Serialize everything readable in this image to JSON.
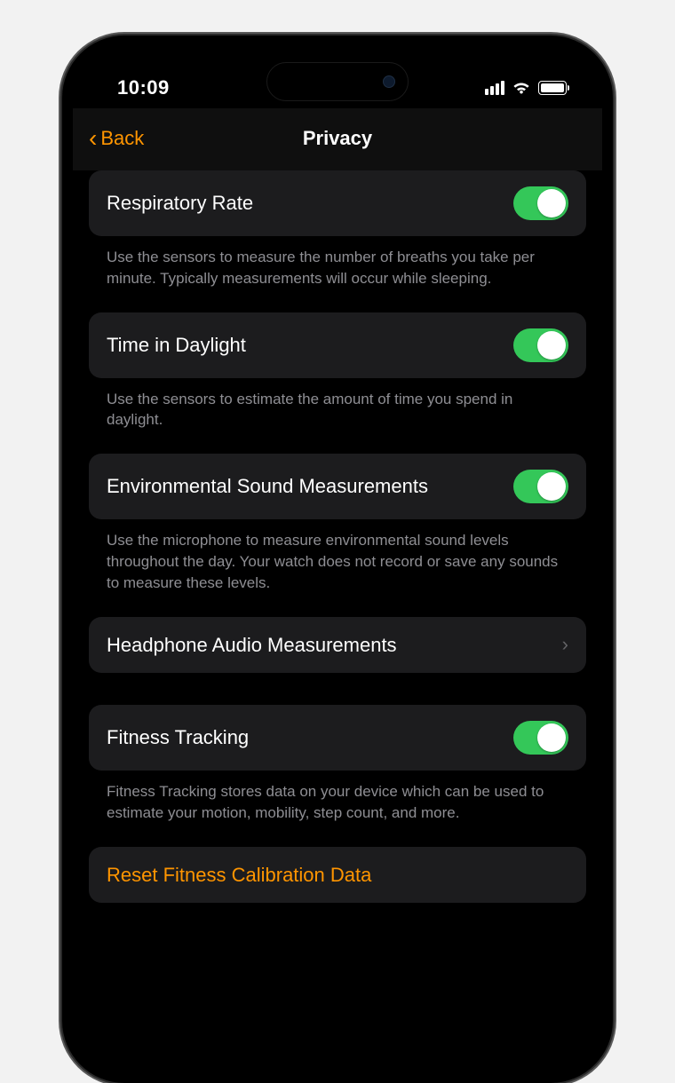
{
  "statusBar": {
    "time": "10:09"
  },
  "nav": {
    "backLabel": "Back",
    "title": "Privacy"
  },
  "settings": {
    "respiratoryRate": {
      "label": "Respiratory Rate",
      "on": true,
      "footer": "Use the sensors to measure the number of breaths you take per minute. Typically measurements will occur while sleeping."
    },
    "timeInDaylight": {
      "label": "Time in Daylight",
      "on": true,
      "footer": "Use the sensors to estimate the amount of time you spend in daylight."
    },
    "envSound": {
      "label": "Environmental Sound Measurements",
      "on": true,
      "footer": "Use the microphone to measure environmental sound levels throughout the day. Your watch does not record or save any sounds to measure these levels."
    },
    "headphoneAudio": {
      "label": "Headphone Audio Measurements"
    },
    "fitnessTracking": {
      "label": "Fitness Tracking",
      "on": true,
      "footer": "Fitness Tracking stores data on your device which can be used to estimate your motion, mobility, step count, and more."
    },
    "resetCalibration": {
      "label": "Reset Fitness Calibration Data"
    }
  },
  "colors": {
    "accent": "#ff9500",
    "toggleOn": "#34c759",
    "rowBg": "#1c1c1e",
    "secondaryText": "#8e8e93"
  }
}
